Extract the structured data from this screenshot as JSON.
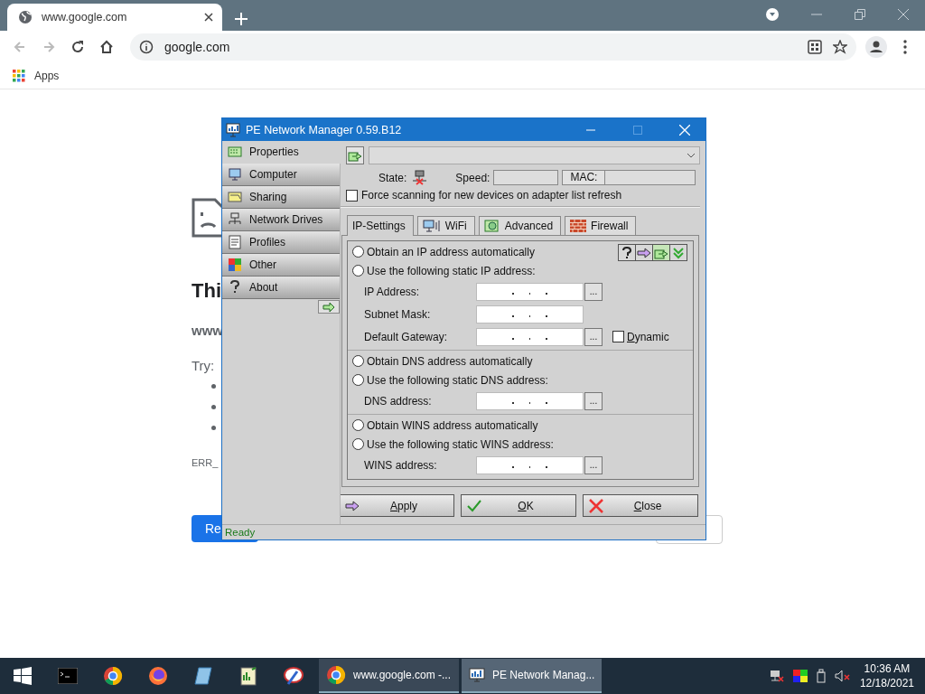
{
  "browser": {
    "tab_title": "www.google.com",
    "address": "google.com",
    "nav": [
      {
        "kind": "back",
        "disabled": true
      },
      {
        "kind": "forward",
        "disabled": true
      },
      {
        "kind": "reload",
        "disabled": false
      },
      {
        "kind": "home",
        "disabled": false
      }
    ],
    "bookmarks": [
      {
        "label": "Apps"
      }
    ]
  },
  "error_page": {
    "heading": "Thi",
    "url": "www",
    "try_label": "Try:",
    "error_code": "ERR_",
    "buttons": [
      {
        "kind": "primary",
        "label": "Re"
      },
      {
        "kind": "secondary"
      }
    ]
  },
  "dialog": {
    "title": "PE Network Manager 0.59.B12",
    "sidebar": [
      {
        "label": "Properties",
        "selected": true
      },
      {
        "label": "Computer",
        "selected": false
      },
      {
        "label": "Sharing",
        "selected": false
      },
      {
        "label": "Network Drives",
        "selected": false
      },
      {
        "label": "Profiles",
        "selected": false
      },
      {
        "label": "Other",
        "selected": false
      },
      {
        "label": "About",
        "selected": false
      }
    ],
    "state_label": "State:",
    "speed_label": "Speed:",
    "mac_label": "MAC:",
    "force_scan": {
      "label": "Force scanning for new devices on adapter list refresh",
      "checked": false
    },
    "tabs": [
      {
        "label": "IP-Settings",
        "selected": true
      },
      {
        "label": "WiFi",
        "selected": false
      },
      {
        "label": "Advanced",
        "selected": false
      },
      {
        "label": "Firewall",
        "selected": false
      }
    ],
    "sections": [
      {
        "tools": true,
        "options": [
          {
            "label": "Obtain an IP address automatically",
            "selected": false
          },
          {
            "label": "Use the following static IP address:",
            "selected": false
          }
        ],
        "fields": [
          {
            "label": "IP Address:",
            "button": "..."
          },
          {
            "label": "Subnet Mask:"
          },
          {
            "label": "Default Gateway:",
            "button": "...",
            "dynamic": {
              "label": "Dynamic",
              "checked": false
            }
          }
        ]
      },
      {
        "tools": false,
        "options": [
          {
            "label": "Obtain DNS address automatically",
            "selected": false
          },
          {
            "label": "Use the following static DNS address:",
            "selected": false
          }
        ],
        "fields": [
          {
            "label": "DNS address:",
            "button": "..."
          }
        ]
      },
      {
        "tools": false,
        "options": [
          {
            "label": "Obtain WINS address automatically",
            "selected": false
          },
          {
            "label": "Use the following static WINS address:",
            "selected": false
          }
        ],
        "fields": [
          {
            "label": "WINS address:",
            "button": "..."
          }
        ]
      }
    ],
    "buttons": [
      {
        "kind": "apply",
        "label": "Apply"
      },
      {
        "kind": "ok",
        "label": "OK"
      },
      {
        "kind": "close",
        "label": "Close"
      }
    ],
    "status": "Ready"
  },
  "taskbar": {
    "apps": [
      {
        "kind": "terminal"
      },
      {
        "kind": "chrome"
      },
      {
        "kind": "firefox"
      },
      {
        "kind": "book"
      },
      {
        "kind": "notepad"
      },
      {
        "kind": "paint"
      }
    ],
    "windows": [
      {
        "label": "www.google.com -...",
        "selected": false
      },
      {
        "label": "PE Network Manag...",
        "selected": true
      }
    ],
    "clock": {
      "time": "10:36 AM",
      "date": "12/18/2021"
    }
  }
}
